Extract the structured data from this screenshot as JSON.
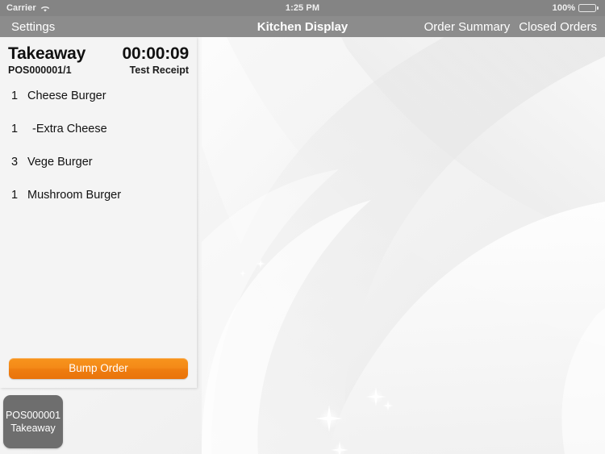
{
  "status_bar": {
    "carrier": "Carrier",
    "wifi_icon": "wifi-icon",
    "time": "1:25 PM",
    "battery_percent": "100%",
    "battery_icon": "battery-full-icon"
  },
  "nav_bar": {
    "settings_label": "Settings",
    "title": "Kitchen Display",
    "order_summary_label": "Order Summary",
    "closed_orders_label": "Closed Orders"
  },
  "order_card": {
    "order_type": "Takeaway",
    "order_reference": "POS000001/1",
    "timer": "00:00:09",
    "receipt_label": "Test Receipt",
    "items": [
      {
        "qty": "1",
        "name": "Cheese Burger",
        "modifier": false
      },
      {
        "qty": "1",
        "name": "-Extra Cheese",
        "modifier": true
      },
      {
        "qty": "3",
        "name": "Vege Burger",
        "modifier": false
      },
      {
        "qty": "1",
        "name": "Mushroom Burger",
        "modifier": false
      }
    ],
    "bump_button_label": "Bump Order"
  },
  "order_tabs": [
    {
      "reference": "POS000001",
      "type": "Takeaway"
    }
  ],
  "colors": {
    "status_bar_bg": "#848484",
    "nav_bar_bg": "#8c8c8c",
    "card_bg": "#f4f4f4",
    "bump_orange": "#f2850f",
    "tab_bg": "#6e6e6e",
    "wallpaper_bg": "#f2f2f2"
  }
}
